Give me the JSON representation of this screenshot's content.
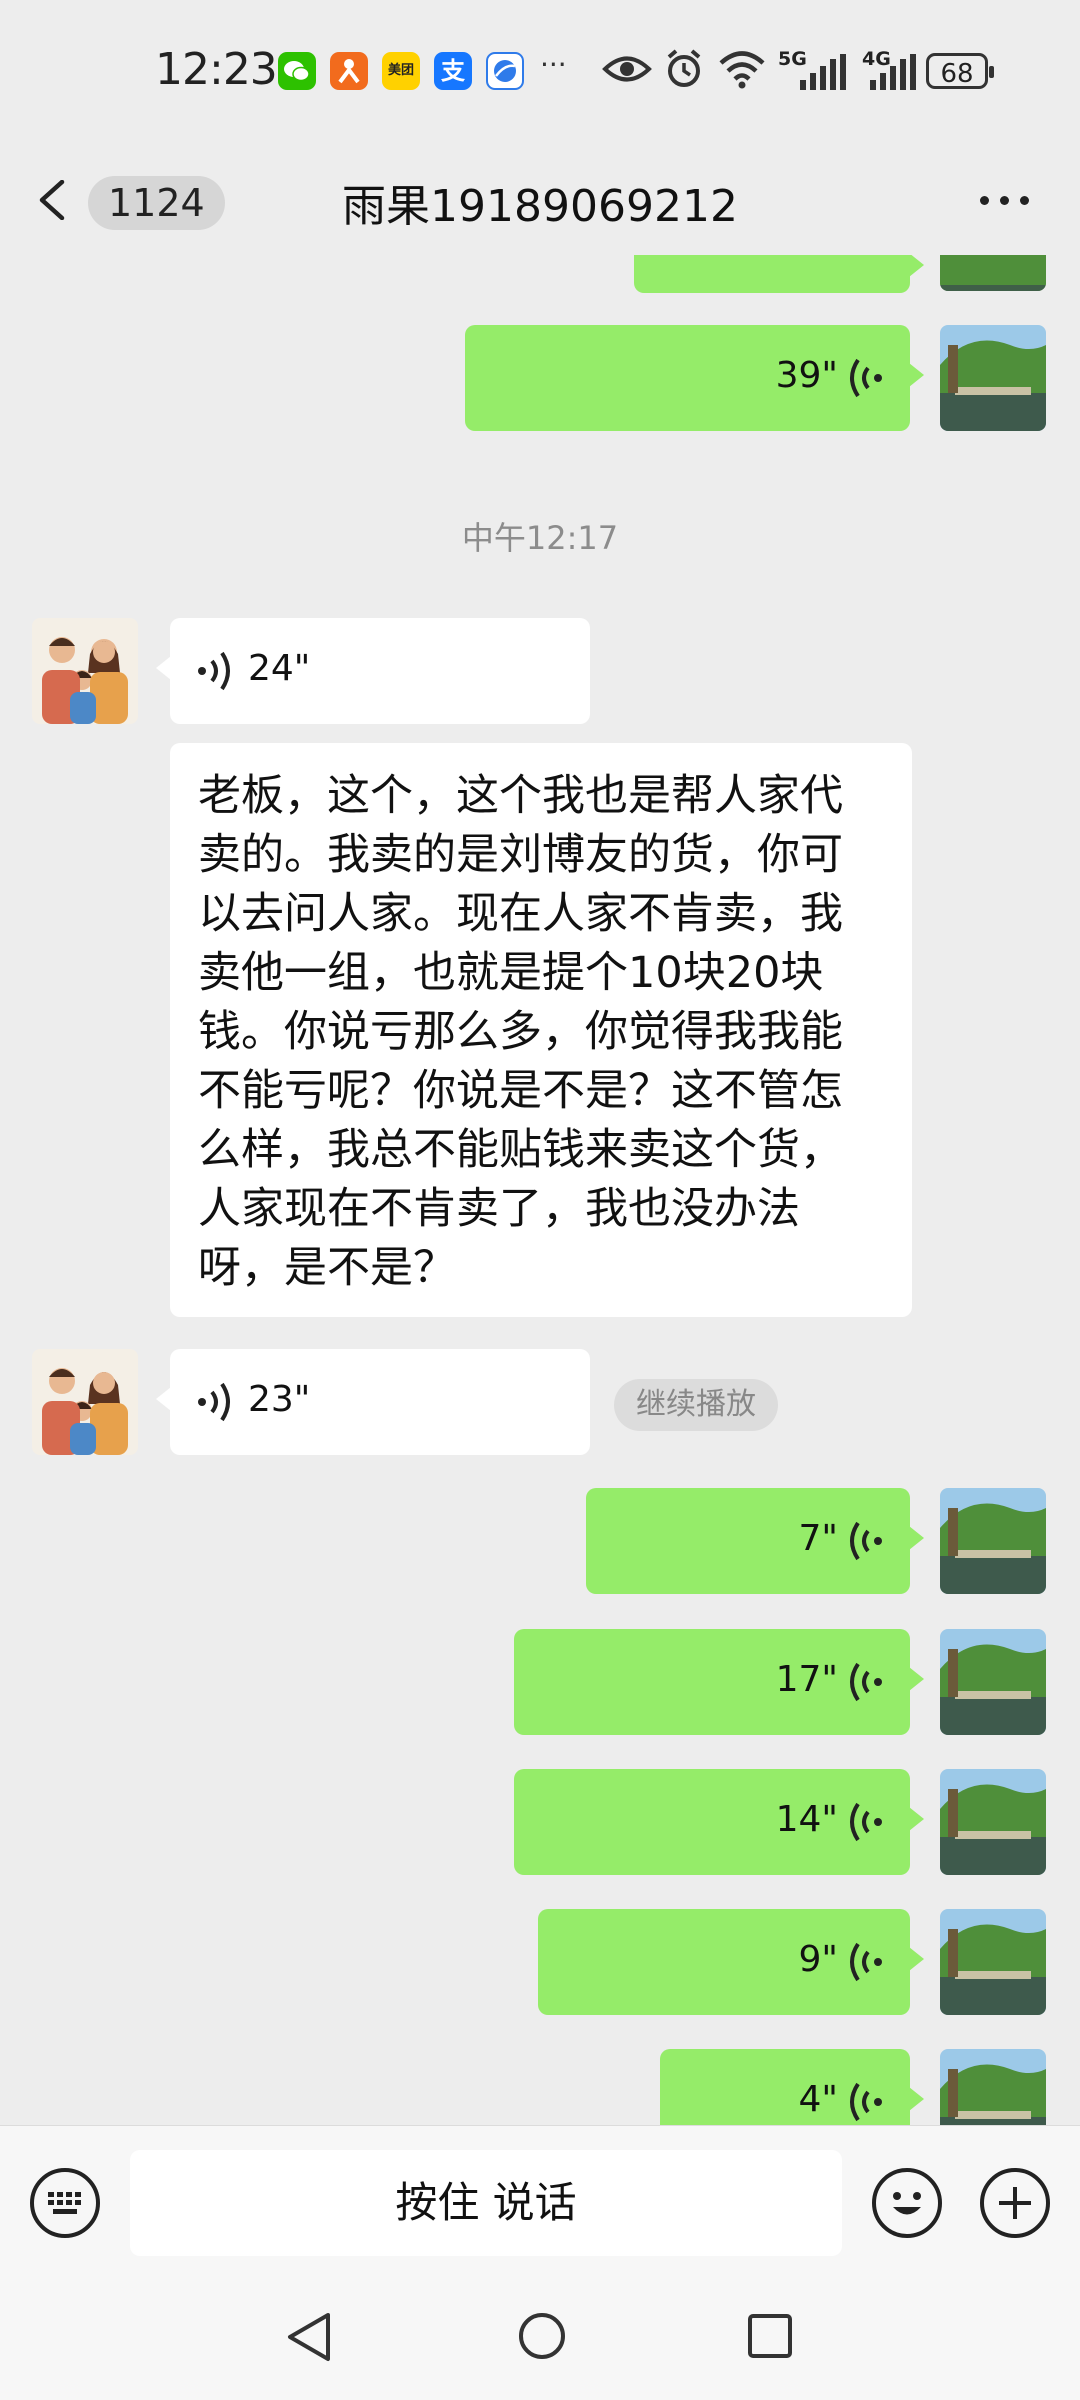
{
  "status_bar": {
    "time": "12:23",
    "apps": [
      {
        "icon": "wechat-icon",
        "label": "",
        "color": "#2dc100"
      },
      {
        "icon": "app-icon",
        "label": "",
        "color": "#f26b1d"
      },
      {
        "icon": "meituan-icon",
        "label": "美团",
        "color": "#ffd100"
      },
      {
        "icon": "alipay-icon",
        "label": "支",
        "color": "#1677ff"
      },
      {
        "icon": "browser-icon",
        "label": "",
        "color": "#2f7bea"
      }
    ],
    "more": "···",
    "network_5g": "5G",
    "network_4g": "4G",
    "battery": "68"
  },
  "nav": {
    "unread_count": "1124",
    "title": "雨果19189069212"
  },
  "messages": {
    "out_partial": {
      "duration": ""
    },
    "out_1": {
      "duration": "39\""
    },
    "timestamp": "中午12:17",
    "in_voice_1": {
      "duration": "24\""
    },
    "in_text": "老板，这个，这个我也是帮人家代卖的。我卖的是刘博友的货，你可以去问人家。现在人家不肯卖，我卖他一组，也就是提个10块20块钱。你说亏那么多，你觉得我我能不能亏呢？你说是不是？这不管怎么样，我总不能贴钱来卖这个货，人家现在不肯卖了，我也没办法呀，是不是？",
    "in_voice_2": {
      "duration": "23\""
    },
    "continue_play": "继续播放",
    "out_2": {
      "duration": "7\""
    },
    "out_3": {
      "duration": "17\""
    },
    "out_4": {
      "duration": "14\""
    },
    "out_5": {
      "duration": "9\""
    },
    "out_6": {
      "duration": "4\""
    }
  },
  "input_bar": {
    "hold_to_talk": "按住 说话"
  },
  "colors": {
    "out_bubble": "#95ec69",
    "in_bubble": "#ffffff",
    "background": "#ededed"
  }
}
